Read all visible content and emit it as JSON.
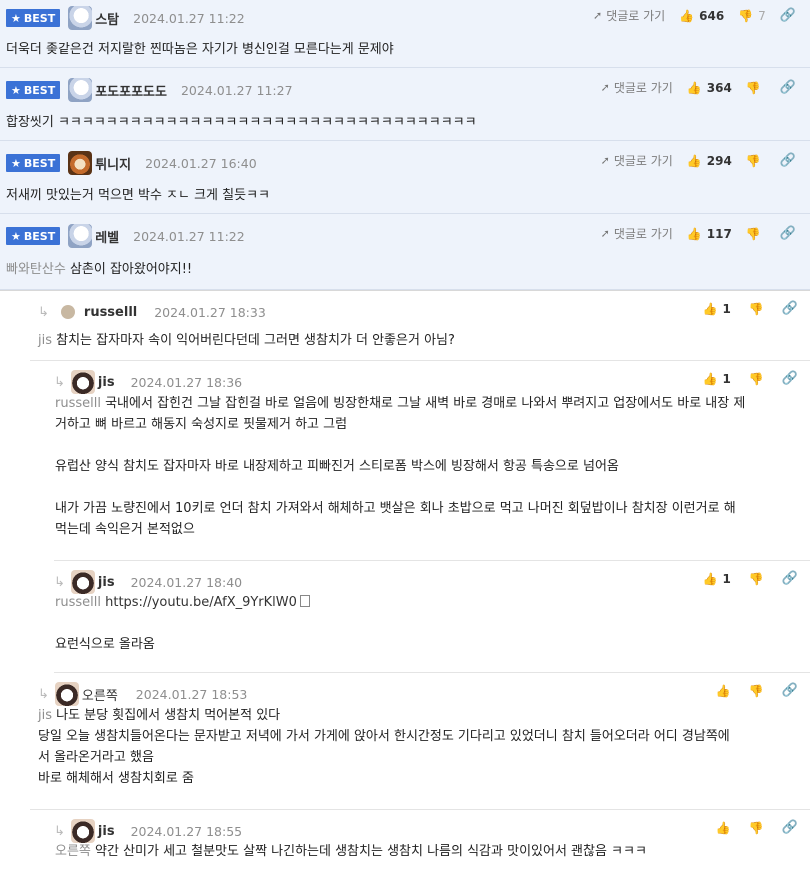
{
  "best_badge_label": "BEST",
  "goto_label": "댓글로 가기",
  "best_comments": [
    {
      "nick": "스탐",
      "date": "2024.01.27 11:22",
      "likes": "646",
      "dislikes": "7",
      "body": "더욱더 좆같은건 저지랄한 찐따놈은 자기가 병신인걸 모른다는게 문제야"
    },
    {
      "nick": "포도포포도도",
      "date": "2024.01.27 11:27",
      "likes": "364",
      "dislikes": "",
      "body": "합장씻기 ㅋㅋㅋㅋㅋㅋㅋㅋㅋㅋㅋㅋㅋㅋㅋㅋㅋㅋㅋㅋㅋㅋㅋㅋㅋㅋㅋㅋㅋㅋㅋㅋㅋㅋㅋ"
    },
    {
      "nick": "튀니지",
      "date": "2024.01.27 16:40",
      "likes": "294",
      "dislikes": "",
      "body": "저새끼 맛있는거 먹으면 박수 ㅈㄴ 크게 칠듯ㅋㅋ"
    },
    {
      "nick": "레벨",
      "date": "2024.01.27 11:22",
      "likes": "117",
      "dislikes": "",
      "mention": "빠와탄산수",
      "body": " 삼촌이 잡아왔어야지!!"
    }
  ],
  "replies": [
    {
      "nick": "russelll",
      "date": "2024.01.27 18:33",
      "likes": "1",
      "mention": "jis",
      "lines": [
        " 참치는 잡자마자 속이 익어버린다던데 그러면 생참치가 더 안좋은거 아님?"
      ]
    },
    {
      "nick": "jis",
      "date": "2024.01.27 18:36",
      "likes": "1",
      "mention": "russelll",
      "lines": [
        " 국내에서 잡힌건 그날 잡힌걸 바로 얼음에 빙장한채로 그날 새벽 바로 경매로 나와서 뿌려지고 업장에서도 바로 내장 제",
        "거하고 뼈 바르고 해동지 숙성지로 핏물제거 하고 그럼",
        "",
        "유럽산 양식 참치도 잡자마자 바로 내장제하고 피빠진거 스티로폼 박스에 빙장해서 항공 특송으로 넘어옴",
        "",
        "내가 가끔 노량진에서 10키로 언더 참치 가져와서 해체하고 뱃살은 회나 초밥으로 먹고 나머진 회덮밥이나 참치장 이런거로 해",
        "먹는데 속익은거 본적없으"
      ]
    },
    {
      "nick": "jis",
      "date": "2024.01.27 18:40",
      "likes": "1",
      "mention": "russelll",
      "link": " https://youtu.be/AfX_9YrKlW0",
      "lines": [
        "",
        "요런식으로 올라옴"
      ]
    },
    {
      "nick": "오른쪽",
      "date": "2024.01.27 18:53",
      "likes": "",
      "mention": "jis",
      "lines": [
        " 나도 분당 횟집에서 생참치 먹어본적 있다",
        "당일 오늘 생참치들어온다는 문자받고 저녁에 가서 가게에 앉아서 한시간정도 기다리고 있었더니 참치 들어오더라 어디 경남쪽에",
        "서 올라온거라고 했음",
        "바로 해체해서 생참치회로 줌"
      ]
    },
    {
      "nick": "jis",
      "date": "2024.01.27 18:55",
      "likes": "",
      "mention": "오른쪽",
      "lines": [
        " 약간 산미가 세고 철분맛도 살짝 나긴하는데 생참치는 생참치 나름의 식감과 맛이있어서 괜찮음 ㅋㅋㅋ"
      ]
    }
  ]
}
